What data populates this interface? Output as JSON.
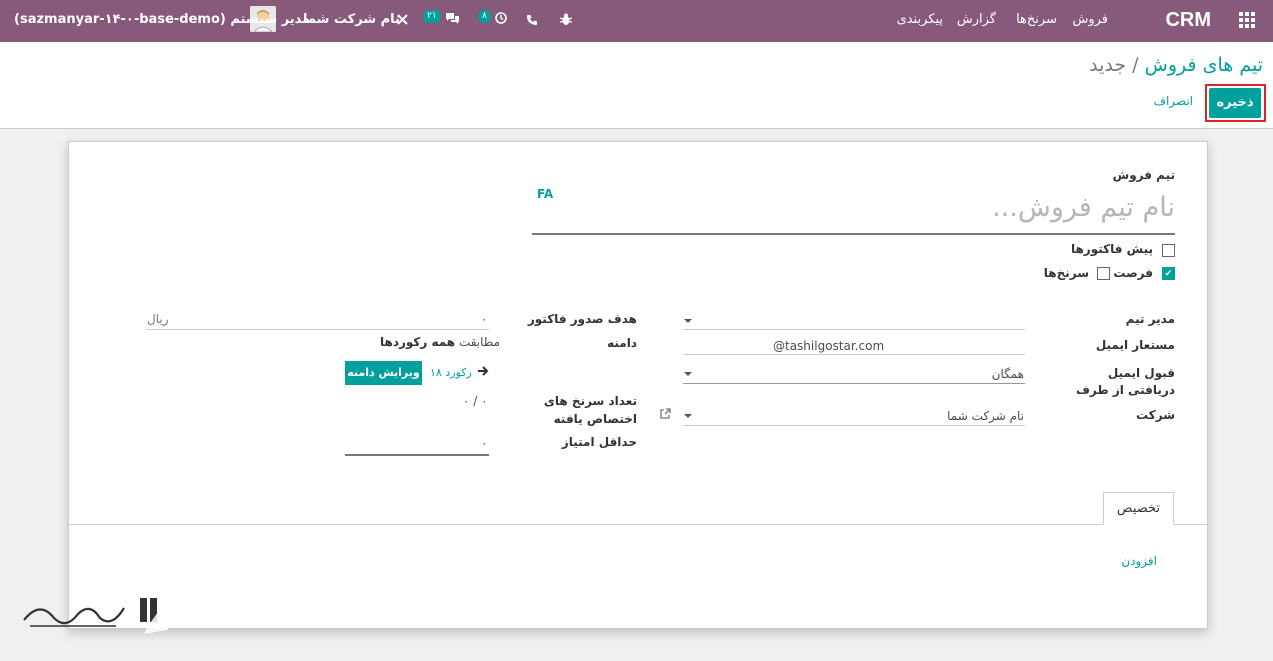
{
  "navbar": {
    "brand": "CRM",
    "menu": [
      "فروش",
      "سرنخ‌ها",
      "گزارش",
      "پیکربندی"
    ],
    "chat_count": "۲۱",
    "activity_count": "۸",
    "company": "نام شرکت شما",
    "user": "مدیر سیستم (sazmanyar-۱۴-۰-base-demo)",
    "icons": [
      "apps-icon",
      "bug-icon",
      "phone-icon",
      "clock-icon",
      "chat-icon",
      "tools-icon"
    ]
  },
  "breadcrumb": {
    "parent": "تیم های فروش",
    "sep": "/",
    "current": "جدید"
  },
  "buttons": {
    "save": "ذخیره",
    "discard": "انصراف"
  },
  "form": {
    "team_label": "تیم فروش",
    "name_placeholder": "نام تیم فروش...",
    "lang": "FA",
    "check_quotations": "پیش فاکتورها",
    "check_opportunity": "فرصت",
    "check_leads": "سرنخ‌ها",
    "manager_label": "مدیر تیم",
    "alias_label": "مستعار ایمیل",
    "alias_domain": "@tashilgostar.com",
    "accept_label": "قبول ایمیل دریافتی از طرف",
    "accept_value": "همگان",
    "company_label": "شرکت",
    "company_value": "نام شرکت شما",
    "invoice_target_label": "هدف صدور فاکتور",
    "invoice_target_value": "۰",
    "currency": "ریال",
    "domain_label": "دامنه",
    "match_prefix": "مطابقت",
    "match_all": "همه رکوردها",
    "records": "۱۸ رکورد",
    "edit_domain": "ویرایش دامنه",
    "assigned_label": "تعداد سرنخ های اختصاص یافته",
    "assigned_value": "۰ / ۰",
    "min_score_label": "حداقل امتیاز",
    "min_score_value": "۰"
  },
  "tabs": {
    "assignment": "تخصیص",
    "add": "افزودن"
  },
  "colors": {
    "navbar": "#875a7b",
    "accent": "#00a09d",
    "highlight": "#d9262b"
  }
}
